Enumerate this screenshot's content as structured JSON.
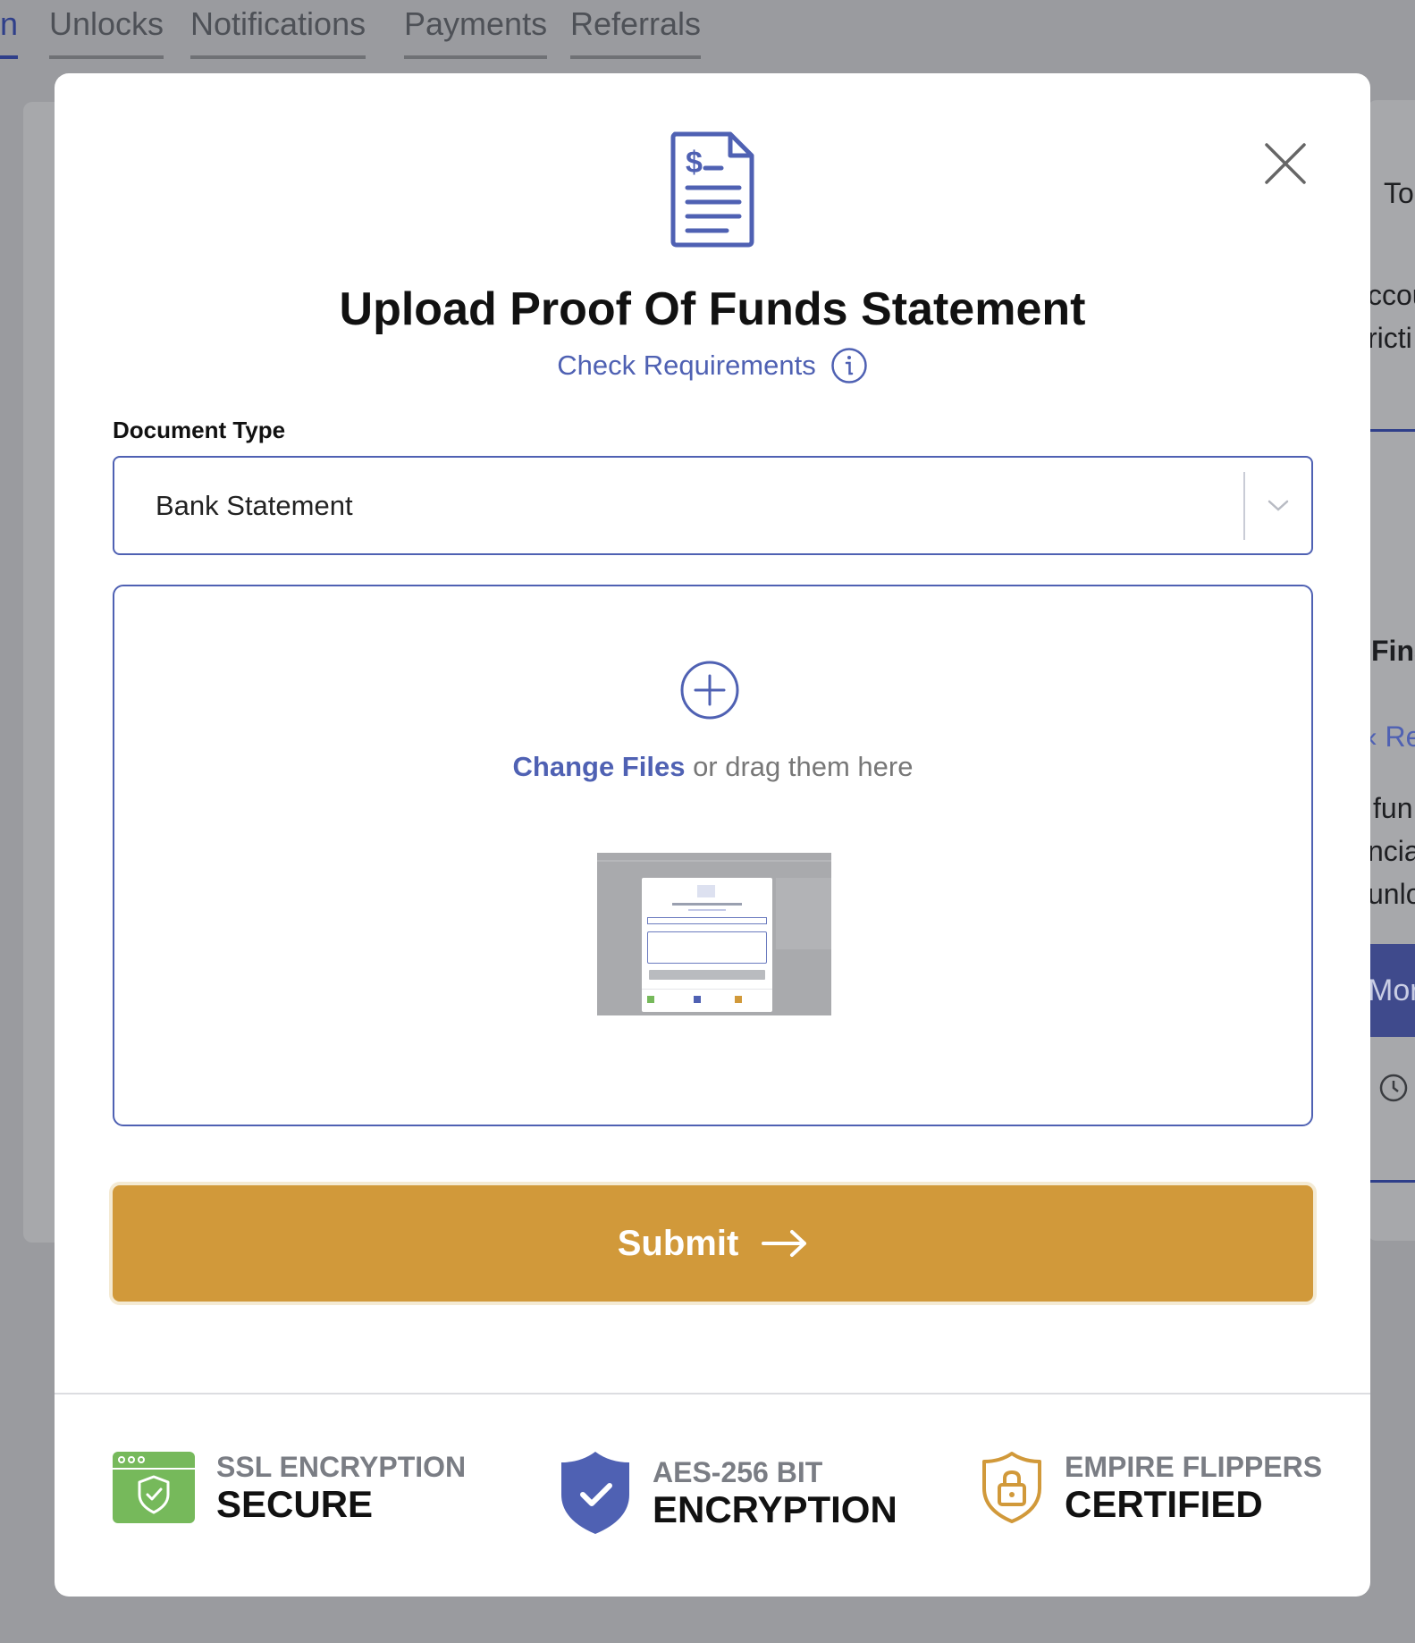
{
  "background": {
    "tabs": [
      {
        "label": "n",
        "active": true
      },
      {
        "label": "Unlocks"
      },
      {
        "label": "Notifications"
      },
      {
        "label": "Payments"
      },
      {
        "label": "Referrals"
      }
    ],
    "peek_text": [
      "To",
      "ccou",
      "ricti",
      "Fina",
      "‹ Re",
      "fun",
      "ncia",
      "unlo",
      "Mor"
    ]
  },
  "modal": {
    "doc_icon": "dollar-document-icon",
    "close_icon": "close-icon",
    "title": "Upload Proof Of Funds Statement",
    "requirements_link": "Check Requirements",
    "document_type": {
      "label": "Document Type",
      "value": "Bank Statement"
    },
    "dropzone": {
      "link_text": "Change Files",
      "suffix_text": " or drag them here",
      "thumbnail": "uploaded-file-thumbnail"
    },
    "submit_label": "Submit",
    "badges": [
      {
        "icon": "browser-shield-icon",
        "sub": "SSL ENCRYPTION",
        "main": "SECURE",
        "color": "#76b95b"
      },
      {
        "icon": "shield-check-icon",
        "sub": "AES-256 BIT",
        "main": "ENCRYPTION",
        "color": "#4f61b3"
      },
      {
        "icon": "lock-shield-icon",
        "sub": "EMPIRE FLIPPERS",
        "main": "CERTIFIED",
        "color": "#d1993a"
      }
    ]
  },
  "colors": {
    "accent": "#4f61b3",
    "submit": "#d1993a",
    "overlay": "#9a9b9f"
  }
}
